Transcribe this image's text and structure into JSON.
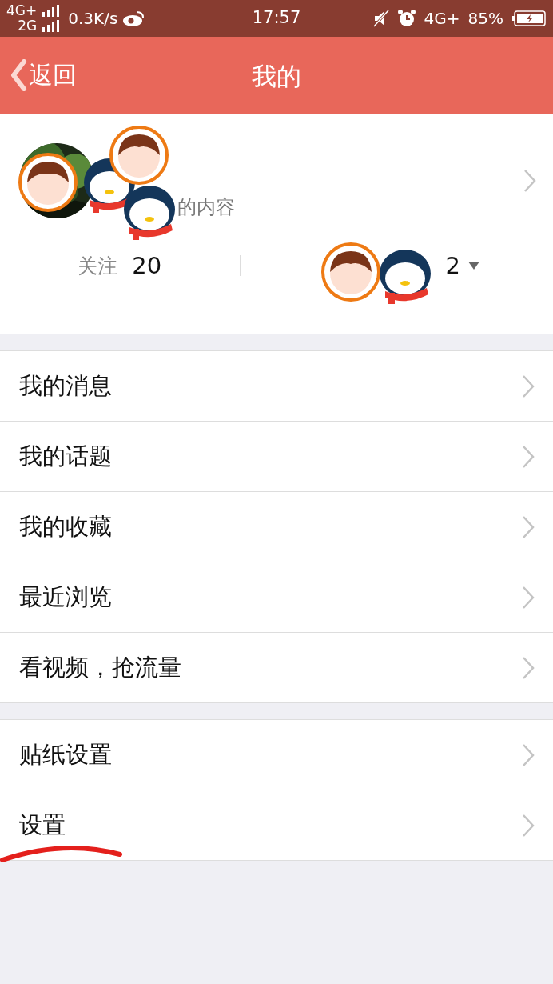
{
  "status_bar": {
    "network_top": "4G+",
    "network_bottom": "2G",
    "speed": "0.3K/s",
    "time": "17:57",
    "network_right": "4G+",
    "battery": "85%"
  },
  "nav": {
    "back": "返回",
    "title": "我的"
  },
  "profile": {
    "subtitle": "的内容",
    "following_label": "关注",
    "following_count": "20",
    "followers_count": "2"
  },
  "sections": [
    {
      "items": [
        {
          "label": "我的消息"
        },
        {
          "label": "我的话题"
        },
        {
          "label": "我的收藏"
        },
        {
          "label": "最近浏览"
        },
        {
          "label": "看视频，抢流量"
        }
      ]
    },
    {
      "items": [
        {
          "label": "贴纸设置"
        },
        {
          "label": "设置"
        }
      ]
    }
  ],
  "annotation": {
    "kind": "underline"
  }
}
